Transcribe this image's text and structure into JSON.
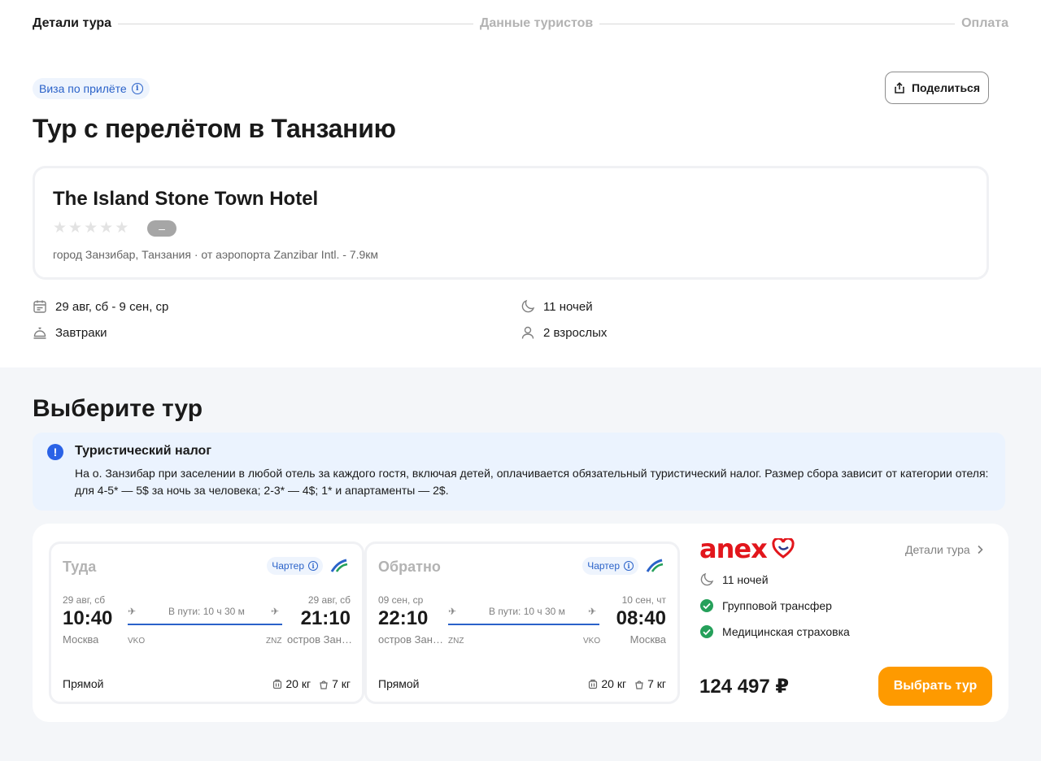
{
  "steps": [
    "Детали тура",
    "Данные туристов",
    "Оплата"
  ],
  "visa_badge": "Виза по прилёте",
  "share_label": "Поделиться",
  "page_title": "Тур с перелётом в Танзанию",
  "hotel": {
    "name": "The Island Stone Town Hotel",
    "stars_filled": 0,
    "stars_total": 5,
    "rating": "–",
    "location": "город Занзибар, Танзания · от аэропорта Zanzibar Intl. - 7.9км"
  },
  "trip": {
    "dates": "29 авг, сб - 9 сен, ср",
    "nights": "11 ночей",
    "meals": "Завтраки",
    "guests": "2 взрослых"
  },
  "section_title": "Выберите тур",
  "notice": {
    "title": "Туристический налог",
    "text": "На о. Занзибар при заселении в любой отель за каждого гостя, включая детей, оплачивается обязательный туристический налог. Размер сбора зависит от категории отеля: для 4-5* — 5$ за ночь за человека; 2-3* — 4$; 1* и апартаменты — 2$."
  },
  "flights": [
    {
      "direction": "Туда",
      "charter": "Чартер",
      "dep_date": "29 авг, сб",
      "dep_time": "10:40",
      "dep_city": "Москва",
      "dep_code": "VKO",
      "duration": "В пути: 10 ч 30 м",
      "arr_date": "29 авг, сб",
      "arr_time": "21:10",
      "arr_city": "остров Занзибар",
      "arr_code": "ZNZ",
      "type": "Прямой",
      "baggage": "20 кг",
      "hand": "7 кг"
    },
    {
      "direction": "Обратно",
      "charter": "Чартер",
      "dep_date": "09 сен, ср",
      "dep_time": "22:10",
      "dep_city": "остров Занзибар",
      "dep_code": "ZNZ",
      "duration": "В пути: 10 ч 30 м",
      "arr_date": "10 сен, чт",
      "arr_time": "08:40",
      "arr_city": "Москва",
      "arr_code": "VKO",
      "type": "Прямой",
      "baggage": "20 кг",
      "hand": "7 кг"
    }
  ],
  "operator": {
    "logo_text": "anex",
    "details_label": "Детали тура",
    "nights": "11 ночей",
    "transfer": "Групповой трансфер",
    "insurance": "Медицинская страховка",
    "price": "124 497 ₽",
    "select_label": "Выбрать тур"
  },
  "colors": {
    "accent": "#2a62c9",
    "button": "#fe9a00",
    "brand_red": "#e2161c",
    "check_green": "#25a05a"
  }
}
